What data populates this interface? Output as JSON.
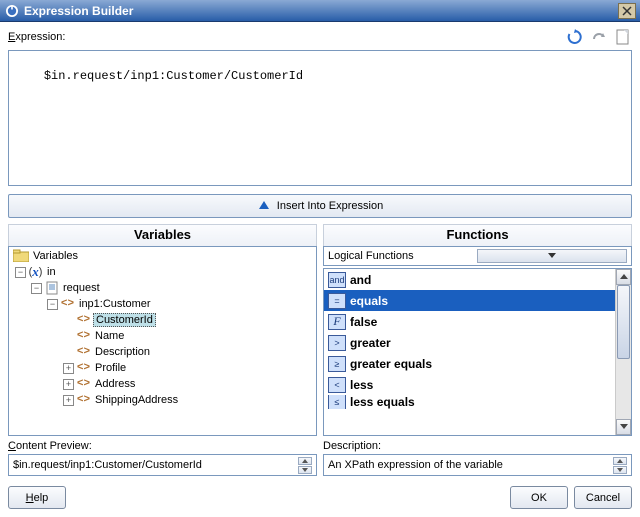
{
  "window": {
    "title": "Expression Builder"
  },
  "labels": {
    "expression": "Expression:",
    "insert": "Insert Into Expression",
    "variables": "Variables",
    "functions": "Functions",
    "content_preview": "Content Preview:",
    "description": "Description:"
  },
  "toolbar": {
    "refresh_icon": "refresh-icon",
    "redo_icon": "redo-icon",
    "new_icon": "new-document-icon"
  },
  "expression": {
    "value": "$in.request/inp1:Customer/CustomerId"
  },
  "variables": {
    "root_label": "Variables",
    "tree": {
      "in": {
        "label": "in",
        "request": {
          "label": "request",
          "customer": {
            "label": "inp1:Customer",
            "children": [
              {
                "label": "CustomerId",
                "selected": true,
                "expand": ""
              },
              {
                "label": "Name",
                "expand": ""
              },
              {
                "label": "Description",
                "expand": ""
              },
              {
                "label": "Profile",
                "expand": "+"
              },
              {
                "label": "Address",
                "expand": "+"
              },
              {
                "label": "ShippingAddress",
                "expand": "+"
              }
            ]
          }
        }
      }
    }
  },
  "functions": {
    "category": "Logical Functions",
    "items": [
      {
        "badge": "and",
        "label": "and",
        "selected": false
      },
      {
        "badge": "=",
        "label": "equals",
        "selected": true
      },
      {
        "badge": "F",
        "label": "false",
        "selected": false
      },
      {
        "badge": ">",
        "label": "greater",
        "selected": false
      },
      {
        "badge": "≥",
        "label": "greater equals",
        "selected": false
      },
      {
        "badge": "<",
        "label": "less",
        "selected": false
      },
      {
        "badge": "≤",
        "label": "less equals",
        "selected": false
      }
    ]
  },
  "preview": {
    "content": "$in.request/inp1:Customer/CustomerId",
    "description": "An XPath expression of the variable"
  },
  "buttons": {
    "help": "Help",
    "ok": "OK",
    "cancel": "Cancel"
  }
}
